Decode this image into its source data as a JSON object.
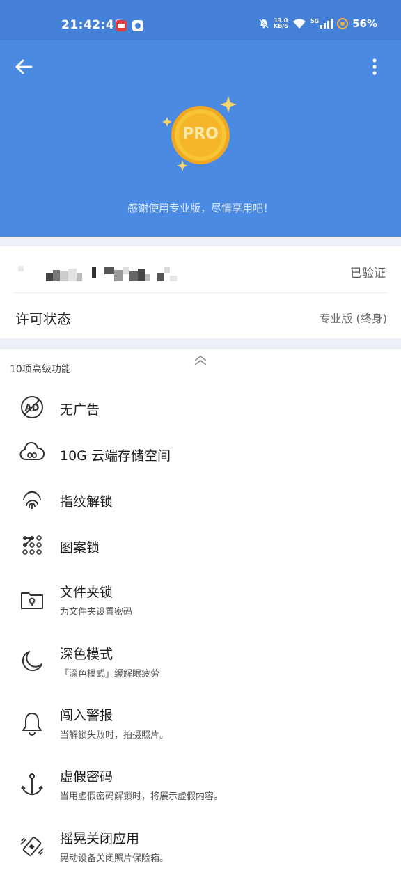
{
  "status_bar": {
    "time": "21:42:41",
    "net_speed_value": "13.0",
    "net_speed_unit": "KB/S",
    "signal_type": "5G",
    "battery": "56%"
  },
  "header": {
    "badge_text": "PRO",
    "message": "感谢使用专业版，尽情享用吧！"
  },
  "account": {
    "verified_label": "已验证"
  },
  "license": {
    "label": "许可状态",
    "value": "专业版 (终身)"
  },
  "features": {
    "section_title": "10项高级功能",
    "items": [
      {
        "icon": "no-ads-icon",
        "title": "无广告",
        "subtitle": ""
      },
      {
        "icon": "cloud-storage-icon",
        "title": "10G 云端存储空间",
        "subtitle": ""
      },
      {
        "icon": "fingerprint-icon",
        "title": "指纹解锁",
        "subtitle": ""
      },
      {
        "icon": "pattern-lock-icon",
        "title": "图案锁",
        "subtitle": ""
      },
      {
        "icon": "folder-lock-icon",
        "title": "文件夹锁",
        "subtitle": "为文件夹设置密码"
      },
      {
        "icon": "dark-mode-icon",
        "title": "深色模式",
        "subtitle": "「深色模式」缓解眼疲劳"
      },
      {
        "icon": "intruder-alert-icon",
        "title": "闯入警报",
        "subtitle": "当解锁失败时，拍摄照片。"
      },
      {
        "icon": "fake-password-icon",
        "title": "虚假密码",
        "subtitle": "当用虚假密码解锁时，将展示虚假内容。"
      },
      {
        "icon": "shake-close-icon",
        "title": "摇晃关闭应用",
        "subtitle": "晃动设备关闭照片保险箱。"
      }
    ]
  },
  "colors": {
    "header_blue": "#4a8ae3",
    "status_blue": "#4580d8",
    "coin_gold": "#f5b62c"
  }
}
